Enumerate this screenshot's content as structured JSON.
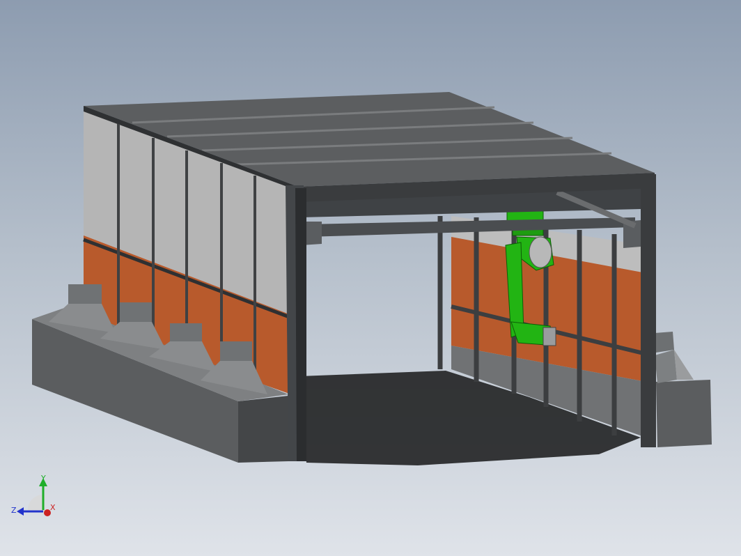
{
  "viewport": {
    "background_top": "#8d9cb0",
    "background_bottom": "#dfe3e9"
  },
  "model": {
    "panel_gray": "#b5b5b5",
    "panel_orange": "#b85a2c",
    "steel_dark": "#4a4d50",
    "roof_gray": "#5c5e60",
    "robot_green": "#22b413",
    "hopper_gray": "#7d8082",
    "base_gray": "#57595b"
  },
  "triad": {
    "y_label": "Y",
    "z_label": "Z",
    "x_label": "X",
    "y_color": "#1fae2a",
    "z_color": "#2233cc",
    "x_color": "#cc2222"
  }
}
